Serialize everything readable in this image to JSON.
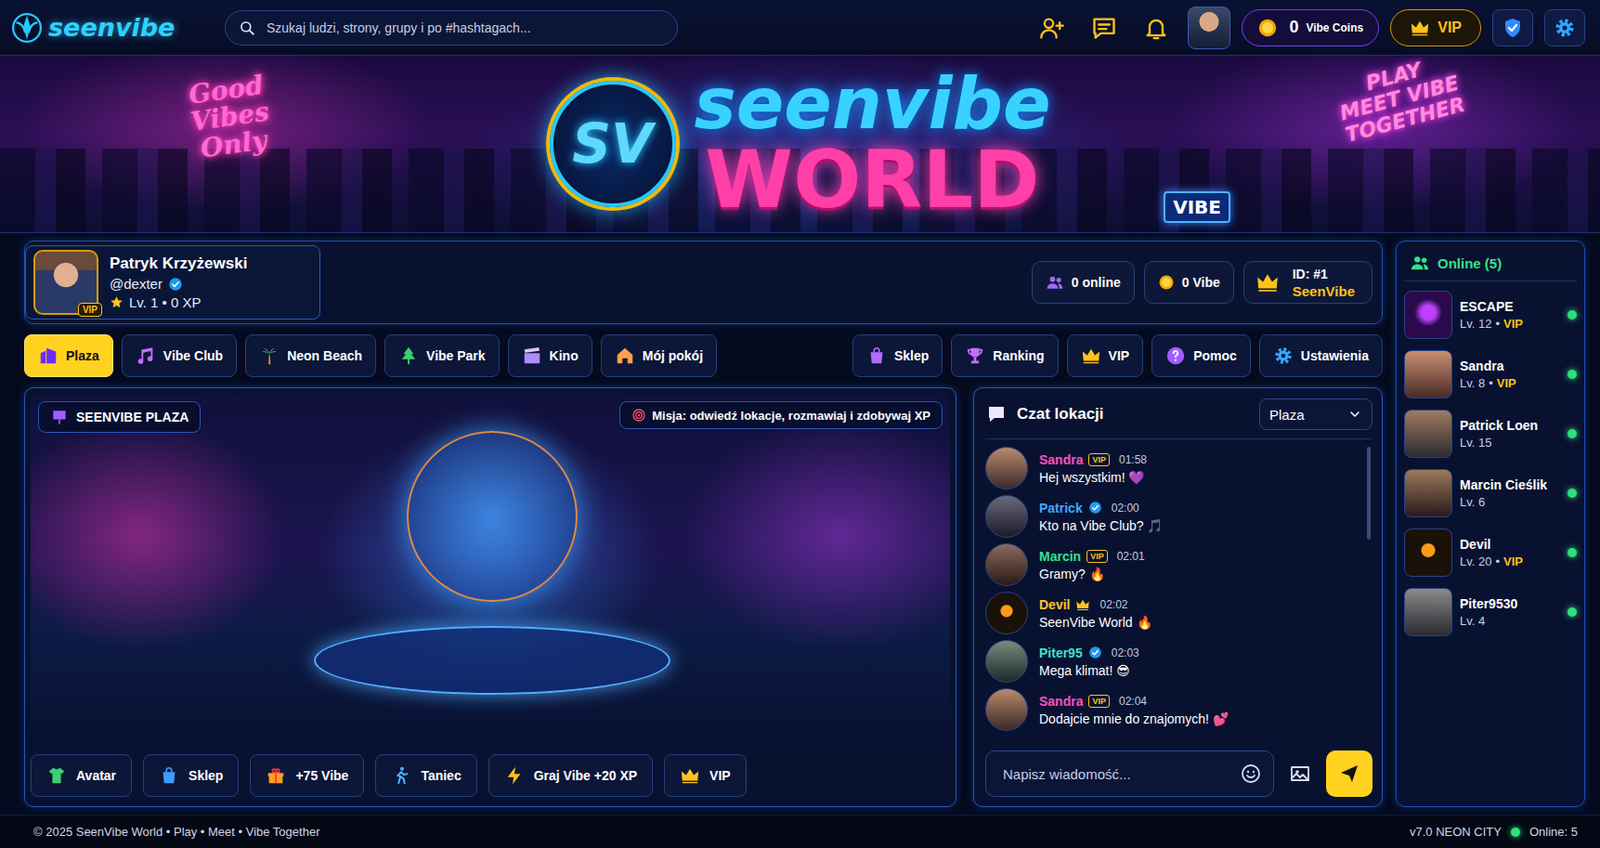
{
  "topbar": {
    "logo": "seenvibe",
    "search_placeholder": "Szukaj ludzi, strony, grupy i po #hashtagach...",
    "coins": "0",
    "coins_label": "Vibe Coins",
    "vip": "VIP"
  },
  "banner": {
    "emblem": "SV",
    "title": "seenvibe",
    "subtitle": "WORLD",
    "left_sign": "Good Vibes Only",
    "right_sign": "PLAY MEET VIBE TOGETHER",
    "vibe_sign": "VIBE"
  },
  "profile": {
    "name": "Patryk Krzyżewski",
    "handle": "@dexter",
    "verified": true,
    "badge": "VIP",
    "level": "Lv. 1 • 0 XP"
  },
  "stats": {
    "online": "0 online",
    "vibe": "0 Vibe",
    "id": "ID: #1",
    "brand": "SeenVibe"
  },
  "locations": [
    {
      "label": "Plaza",
      "selected": true
    },
    {
      "label": "Vibe Club",
      "selected": false
    },
    {
      "label": "Neon Beach",
      "selected": false
    },
    {
      "label": "Vibe Park",
      "selected": false
    },
    {
      "label": "Kino",
      "selected": false
    },
    {
      "label": "Mój pokój",
      "selected": false
    }
  ],
  "menu": [
    "Sklep",
    "Ranking",
    "VIP",
    "Pomoc",
    "Ustawienia"
  ],
  "scene": {
    "label": "SEENVIBE PLAZA",
    "mission": "Misja: odwiedź lokacje, rozmawiaj i zdobywaj XP"
  },
  "actions": [
    "Avatar",
    "Sklep",
    "+75 Vibe",
    "Taniec",
    "Graj Vibe +20 XP",
    "VIP"
  ],
  "chat": {
    "title": "Czat lokacji",
    "room": "Plaza",
    "input_placeholder": "Napisz wiadomość...",
    "messages": [
      {
        "author": "Sandra",
        "kind": "vip",
        "badge": "VIP",
        "time": "01:58",
        "text": "Hej wszystkim! 💜",
        "color": "#ff4fc0"
      },
      {
        "author": "Patrick",
        "kind": "verified",
        "time": "02:00",
        "text": "Kto na Vibe Club? 🎵",
        "color": "#3fa9ff"
      },
      {
        "author": "Marcin",
        "kind": "vip",
        "badge": "VIP",
        "time": "02:01",
        "text": "Gramy? 🔥",
        "color": "#35e08a"
      },
      {
        "author": "Devil",
        "kind": "crown",
        "time": "02:02",
        "text": "SeenVibe World 🔥",
        "color": "#ffc62b"
      },
      {
        "author": "Piter95",
        "kind": "verified",
        "time": "02:03",
        "text": "Mega klimat! 😎",
        "color": "#3fe0d0"
      },
      {
        "author": "Sandra",
        "kind": "vip",
        "badge": "VIP",
        "time": "02:04",
        "text": "Dodajcie mnie do znajomych! 💕",
        "color": "#ff4fc0"
      }
    ]
  },
  "online": {
    "title": "Online (5)",
    "separator": "•",
    "users": [
      {
        "name": "ESCAPE",
        "level": "Lv. 12",
        "badge": "VIP",
        "online": true
      },
      {
        "name": "Sandra",
        "level": "Lv. 8",
        "badge": "VIP",
        "online": true
      },
      {
        "name": "Patrick Loen",
        "level": "Lv. 15",
        "online": true
      },
      {
        "name": "Marcin Cieślik",
        "level": "Lv. 6",
        "online": true
      },
      {
        "name": "Devil",
        "level": "Lv. 20",
        "badge": "VIP",
        "online": true
      },
      {
        "name": "Piter9530",
        "level": "Lv. 4",
        "online": true
      }
    ]
  },
  "footer": {
    "copyright": "© 2025 SeenVibe World • Play • Meet • Vibe Together",
    "version": "v7.0 NEON CITY",
    "online": "Online: 5"
  }
}
